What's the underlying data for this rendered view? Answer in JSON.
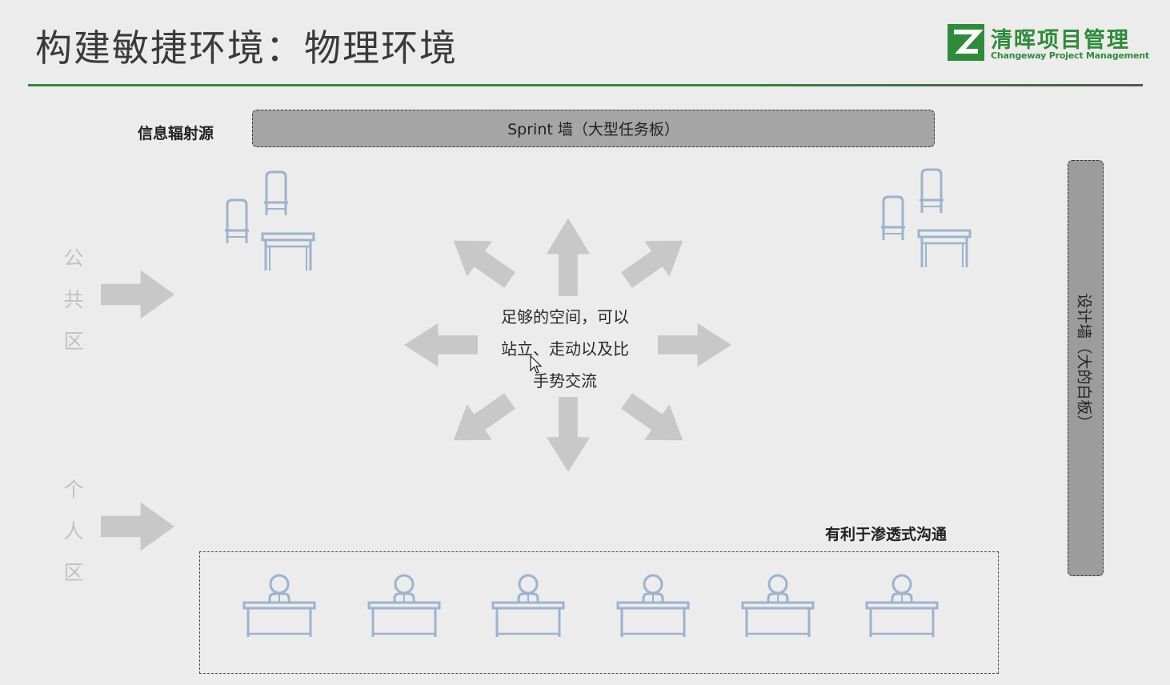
{
  "header": {
    "title": "构建敏捷环境：物理环境",
    "logo_cn": "清晖项目管理",
    "logo_en": "Changeway Project Management"
  },
  "labels": {
    "info_radiator": "信息辐射源",
    "sprint_wall": "Sprint 墙（大型任务板）",
    "design_wall": "设计墙（大的白板）",
    "public_zone": "公共区",
    "private_zone": "个人区",
    "center_text": "足够的空间，可以站立、走动以及比手势交流",
    "osmotic": "有利于渗透式沟通"
  },
  "colors": {
    "brand_green": "#2e8b3a",
    "furniture_blue": "#9cb3cf",
    "arrow_gray": "#c8c8c8",
    "wall_gray": "#a5a5a5"
  },
  "icons": [
    "chair-icon",
    "table-icon",
    "person-at-desk-icon",
    "arrow-icon",
    "mouse-cursor-icon"
  ]
}
